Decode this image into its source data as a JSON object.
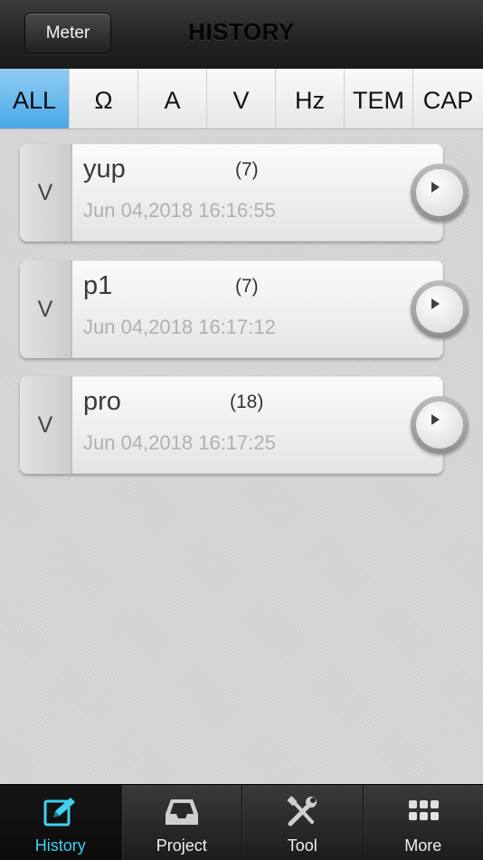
{
  "header": {
    "back_label": "Meter",
    "title": "HISTORY"
  },
  "filters": [
    {
      "label": "ALL",
      "active": true
    },
    {
      "label": "Ω",
      "active": false
    },
    {
      "label": "A",
      "active": false
    },
    {
      "label": "V",
      "active": false
    },
    {
      "label": "Hz",
      "active": false
    },
    {
      "label": "TEM",
      "active": false
    },
    {
      "label": "CAP",
      "active": false
    }
  ],
  "records": [
    {
      "type": "V",
      "name": "yup",
      "count": "(7)",
      "date": "Jun 04,2018 16:16:55"
    },
    {
      "type": "V",
      "name": "p1",
      "count": "(7)",
      "date": "Jun 04,2018 16:17:12"
    },
    {
      "type": "V",
      "name": "pro",
      "count": "(18)",
      "date": "Jun 04,2018 16:17:25"
    }
  ],
  "tabbar": [
    {
      "label": "History",
      "icon": "edit-icon",
      "active": true
    },
    {
      "label": "Project",
      "icon": "inbox-icon",
      "active": false
    },
    {
      "label": "Tool",
      "icon": "tools-icon",
      "active": false
    },
    {
      "label": "More",
      "icon": "grid-icon",
      "active": false
    }
  ],
  "colors": {
    "active_tab": "#4aa8e6",
    "active_tabbar_label": "#3fd1ef"
  }
}
